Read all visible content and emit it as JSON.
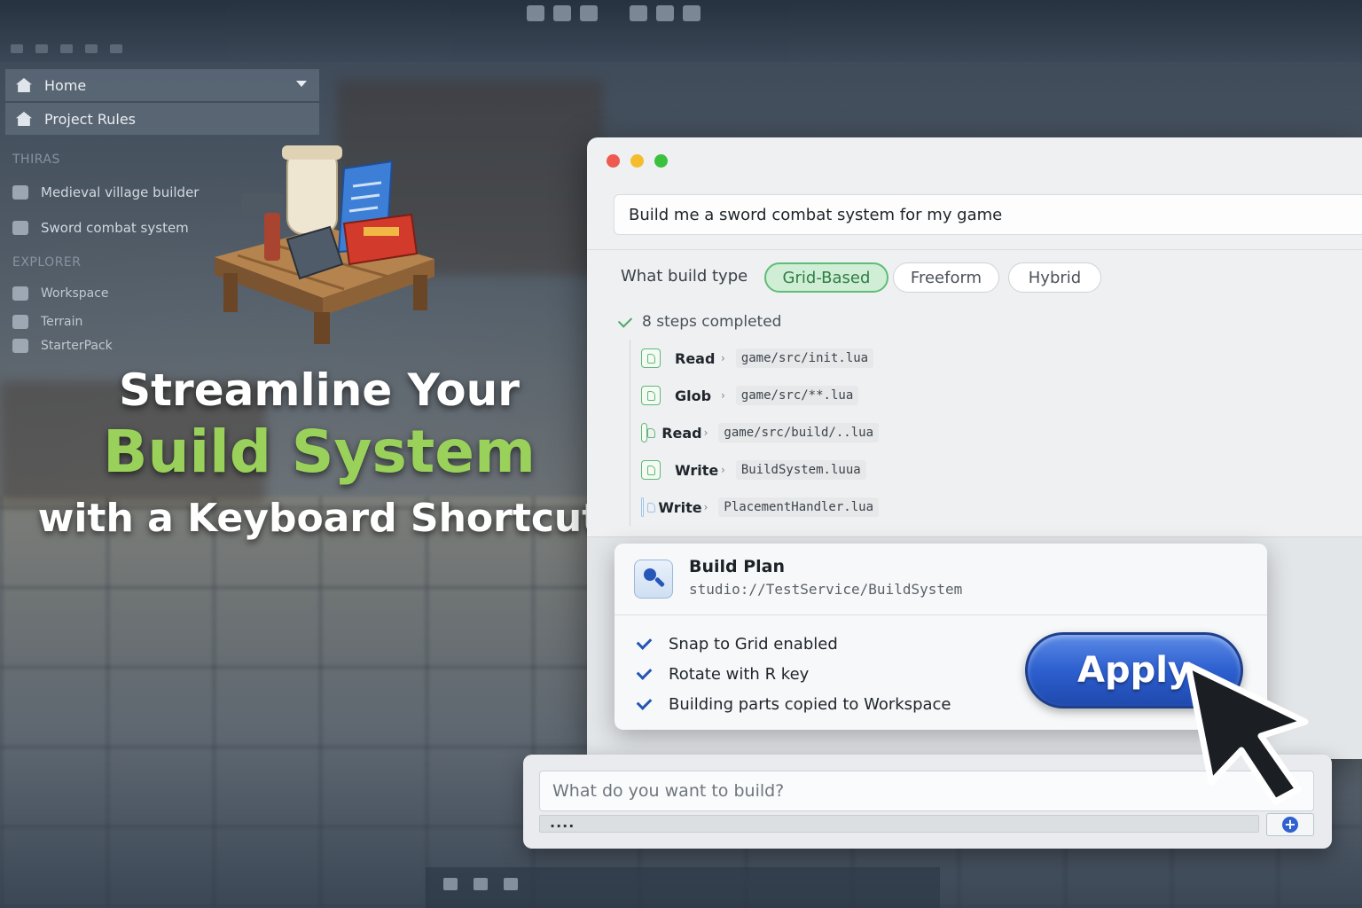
{
  "sidebar": {
    "items": [
      {
        "label": "Home",
        "icon": "home-icon"
      },
      {
        "label": "Project Rules",
        "icon": "home-icon"
      }
    ],
    "section_threads": "THIRAS",
    "threads": [
      {
        "label": "Medieval village builder",
        "icon": "chat-icon"
      },
      {
        "label": "Sword combat system",
        "icon": "chat-icon"
      }
    ],
    "section_explorer": "EXPLORER",
    "explorer": [
      {
        "label": "Workspace",
        "icon": "workspace-icon"
      },
      {
        "label": "Terrain",
        "icon": "terrain-icon"
      },
      {
        "label": "StarterPack",
        "icon": "starterpack-icon"
      }
    ]
  },
  "headline": {
    "line1": "Streamline Your",
    "line2": "Build System",
    "line3": "with a Keyboard Shortcut"
  },
  "window": {
    "prompt": "Build me a sword combat system for my game",
    "build_type_label": "What build type",
    "build_types": [
      {
        "label": "Grid-Based",
        "selected": true
      },
      {
        "label": "Freeform",
        "selected": false
      },
      {
        "label": "Hybrid",
        "selected": false
      }
    ],
    "steps_summary": "8 steps completed",
    "steps": [
      {
        "action": "Read",
        "path": "game/src/init.lua"
      },
      {
        "action": "Glob",
        "path": "game/src/**.lua"
      },
      {
        "action": "Read",
        "path": "game/src/build/..lua"
      },
      {
        "action": "Write",
        "path": "BuildSystem.luua"
      },
      {
        "action": "Write",
        "path": "PlacementHandler.lua"
      }
    ]
  },
  "plan": {
    "title": "Build Plan",
    "path": "studio://TestService/BuildSystem",
    "items": [
      "Snap to Grid enabled",
      "Rotate with R key",
      "Building parts copied to Workspace"
    ],
    "apply_label": "Apply"
  },
  "input": {
    "placeholder": "What do you want to build?",
    "dots": "...."
  },
  "colors": {
    "accent_blue": "#2d5fcf",
    "accent_green": "#9ad15a",
    "chip_selected": "#cfeed5"
  }
}
